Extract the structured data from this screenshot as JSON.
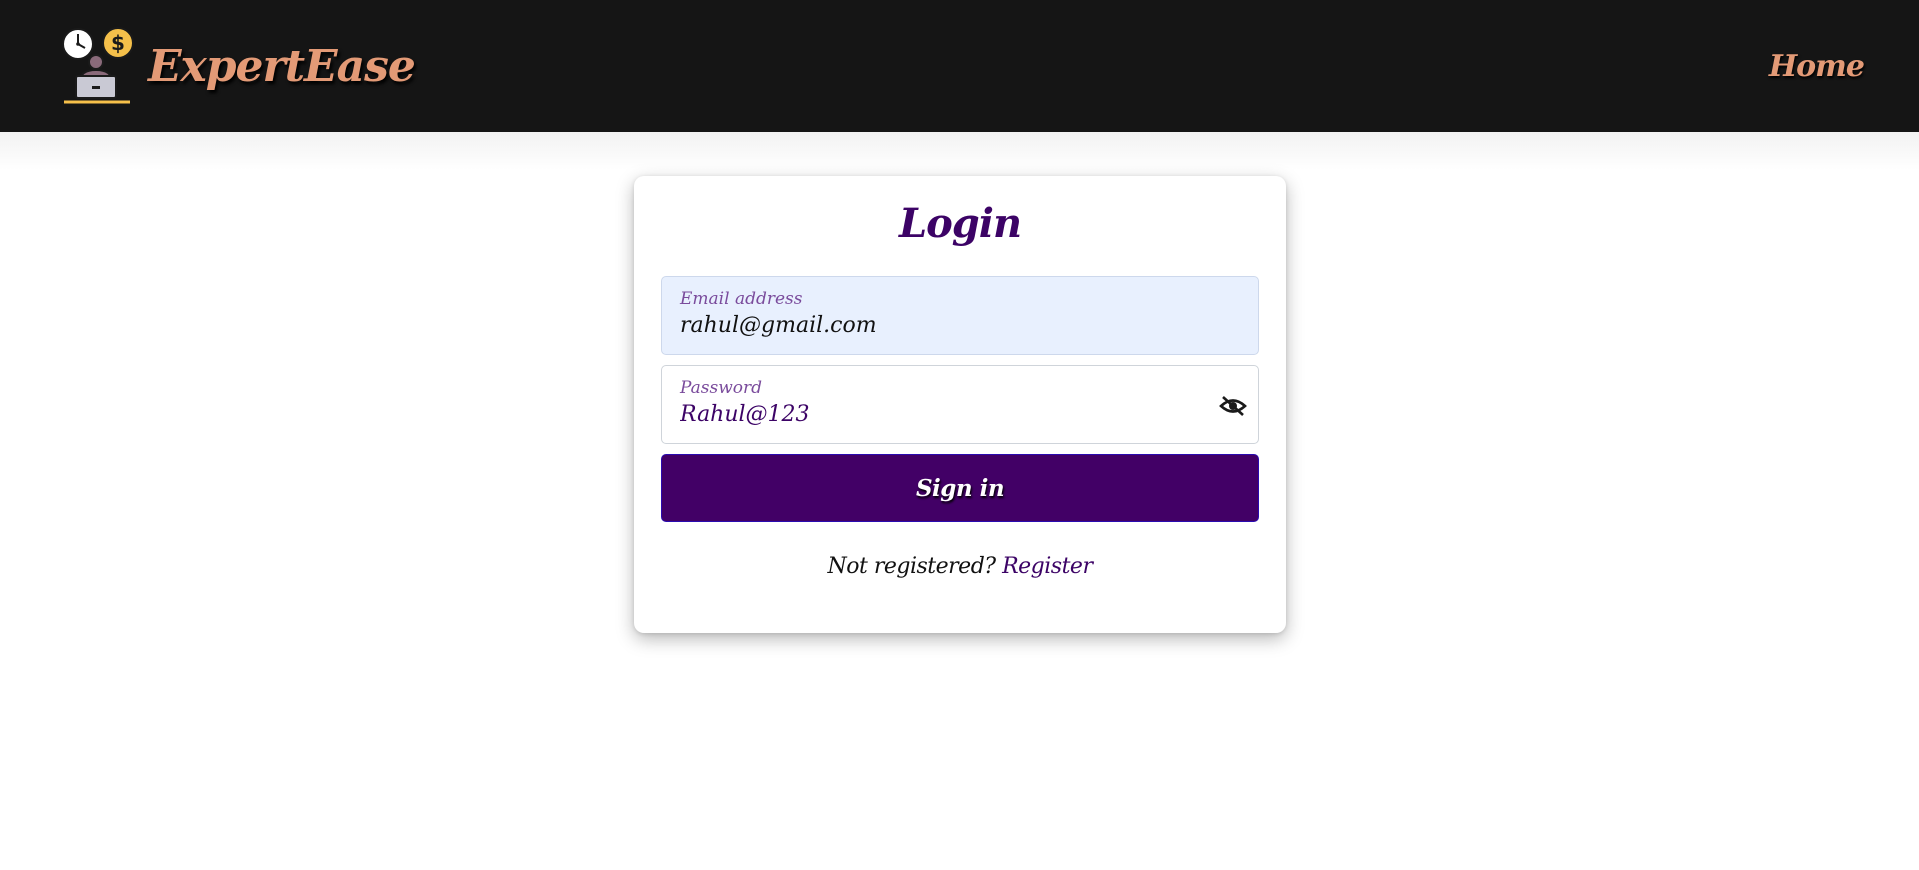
{
  "brand": {
    "name": "ExpertEase",
    "logo_icon": "laptop-clock-dollar-icon"
  },
  "nav": {
    "home_label": "Home"
  },
  "login": {
    "title": "Login",
    "email": {
      "label": "Email address",
      "value": "rahul@gmail.com"
    },
    "password": {
      "label": "Password",
      "value": "Rahul@123",
      "toggle_icon": "eye-slash-icon"
    },
    "submit_label": "Sign in",
    "register_prompt": "Not registered?",
    "register_link": "Register"
  },
  "colors": {
    "navbar_bg": "#151515",
    "brand_accent": "#e39a76",
    "primary": "#420066",
    "email_field_bg": "#e8f0fe"
  }
}
